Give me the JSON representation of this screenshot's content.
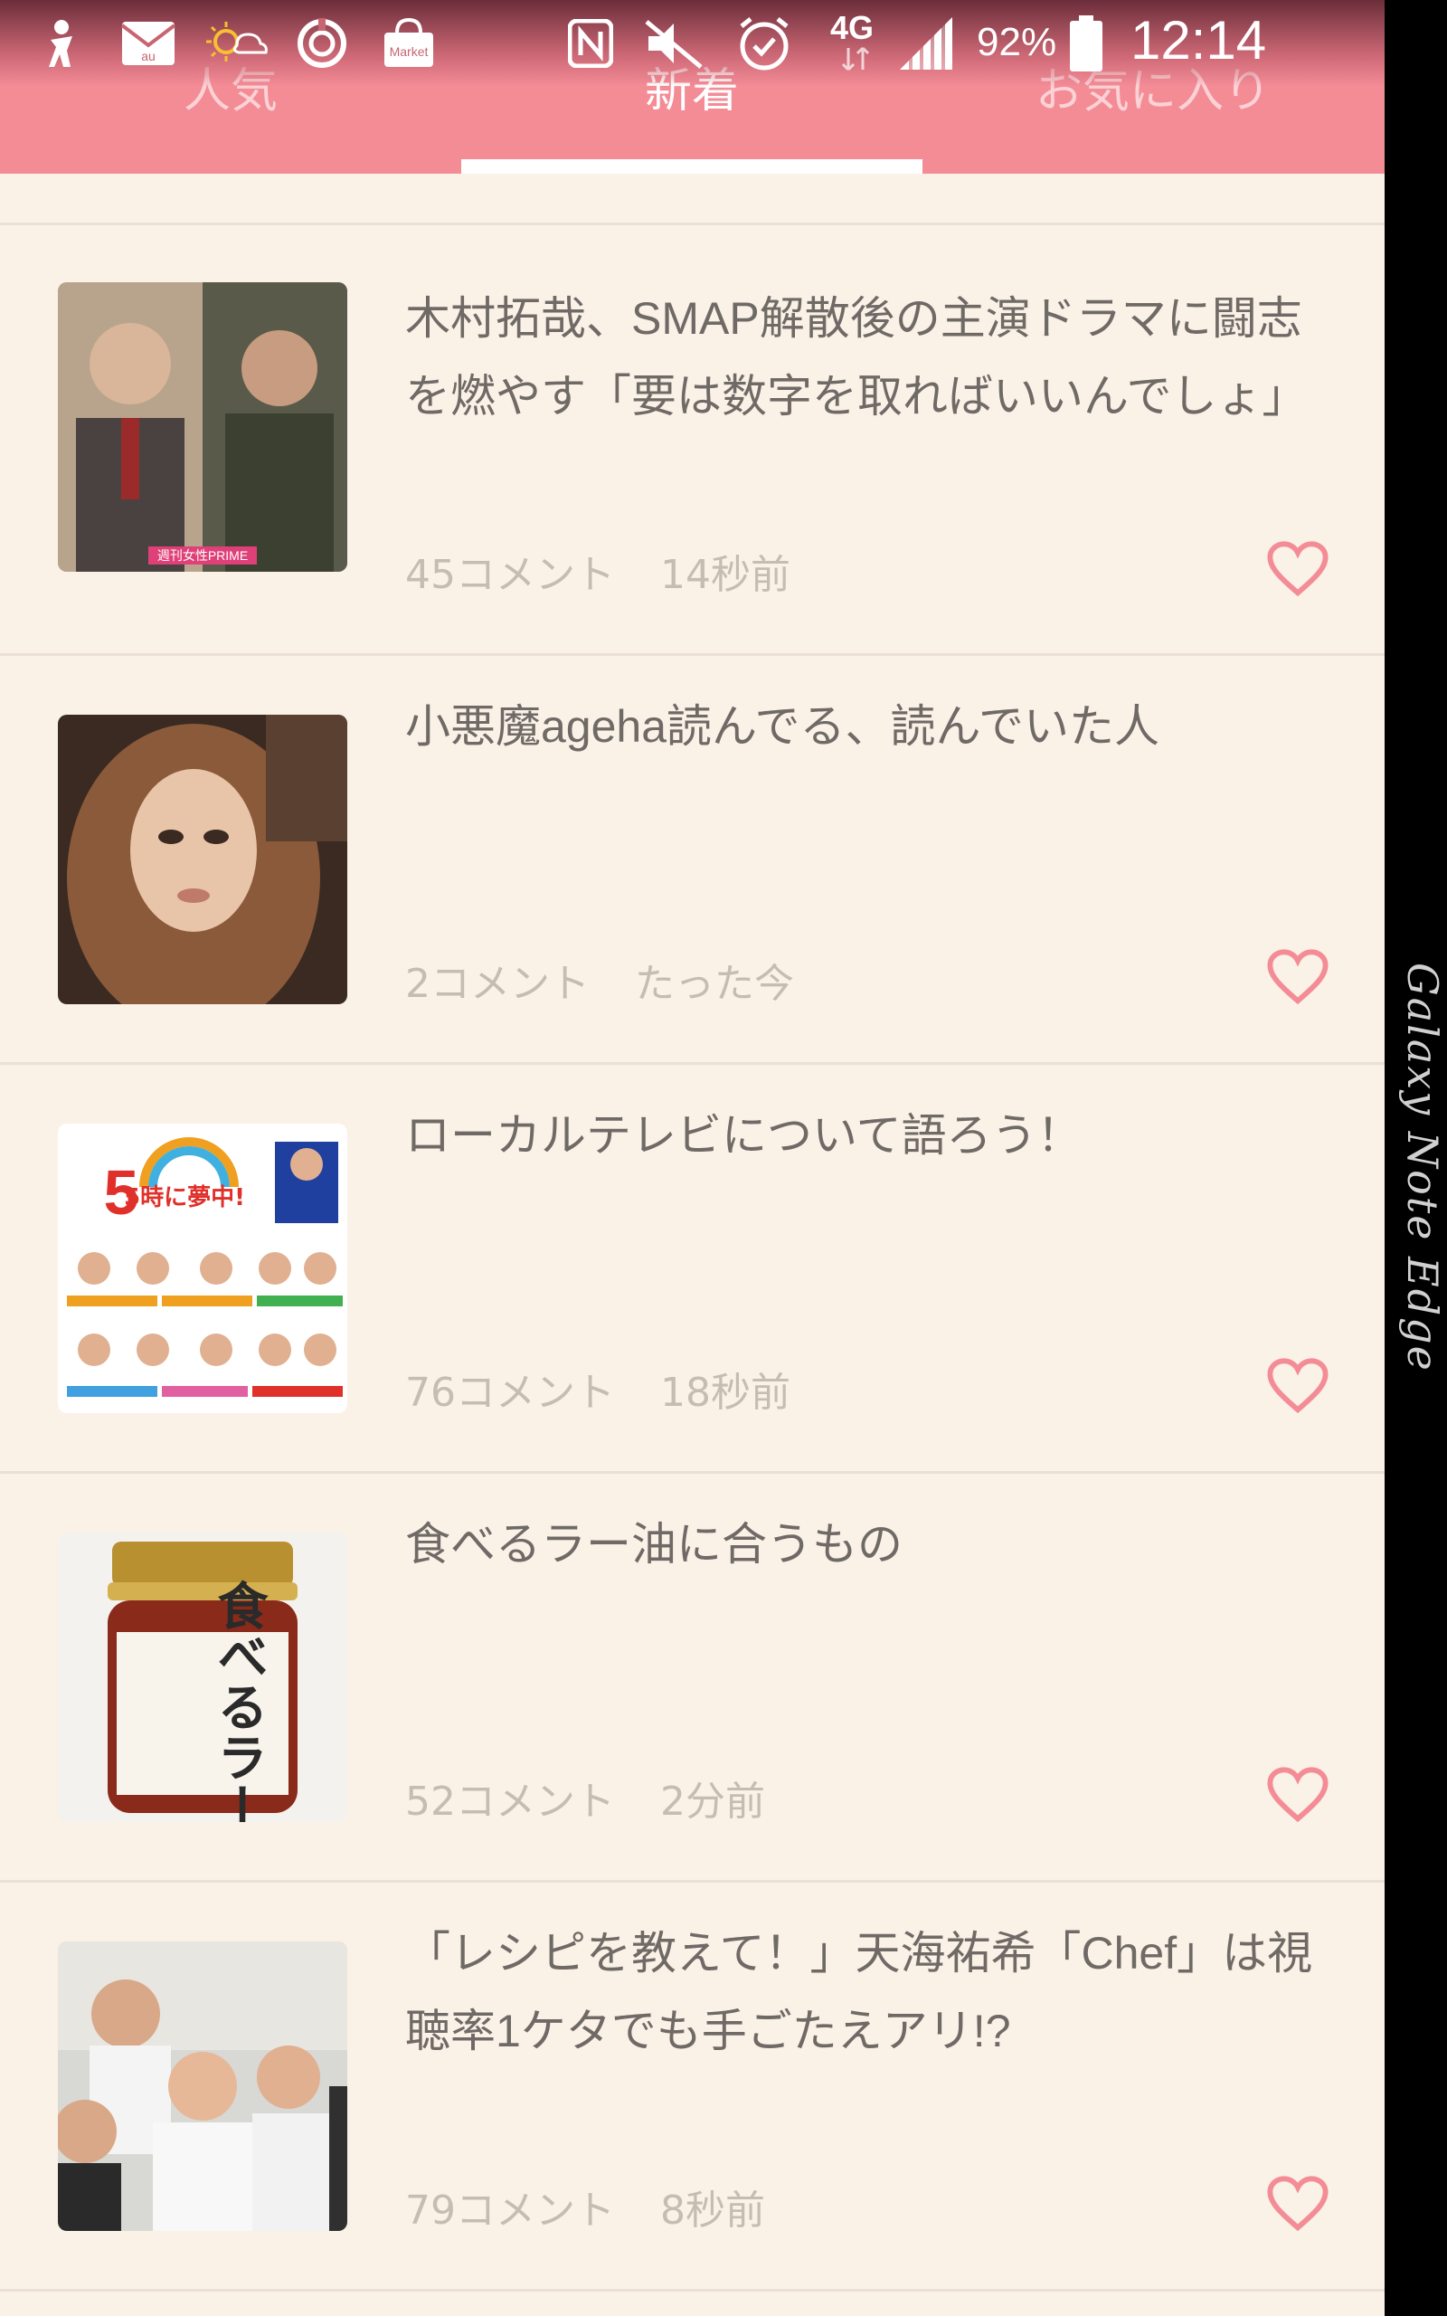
{
  "status_bar": {
    "carrier_icon": "au",
    "market_label": "Market",
    "network": "4G",
    "battery": "92%",
    "time": "12:14",
    "icons": [
      "figure-icon",
      "mail-icon",
      "weather-icon",
      "sync-icon",
      "market-icon",
      "nfc-icon",
      "mute-icon",
      "alarm-icon",
      "network-icon",
      "signal-icon",
      "battery-icon"
    ]
  },
  "tabs": [
    {
      "label": "人気",
      "active": false
    },
    {
      "label": "新着",
      "active": true
    },
    {
      "label": "お気に入り",
      "active": false
    }
  ],
  "edge_label": "Galaxy Note Edge",
  "colors": {
    "header": "#f48c96",
    "background": "#faf1e7",
    "heart": "#f48c96"
  },
  "feed": [
    {
      "title": "木村拓哉、SMAP解散後の主演ドラマに闘志を燃やす「要は数字を取ればいいんでしょ」",
      "comments": "45コメント",
      "time": "14秒前",
      "thumb_caption": "週刊女性PRIME"
    },
    {
      "title": "小悪魔ageha読んでる、読んでいた人",
      "comments": "2コメント",
      "time": "たった今"
    },
    {
      "title": "ローカルテレビについて語ろう！",
      "comments": "76コメント",
      "time": "18秒前",
      "thumb_caption": "5時に夢中!"
    },
    {
      "title": "食べるラー油に合うもの",
      "comments": "52コメント",
      "time": "2分前",
      "thumb_caption": "食べるラー油"
    },
    {
      "title": "「レシピを教えて！」天海祐希「Chef」は視聴率1ケタでも手ごたえアリ!?",
      "comments": "79コメント",
      "time": "8秒前"
    }
  ]
}
